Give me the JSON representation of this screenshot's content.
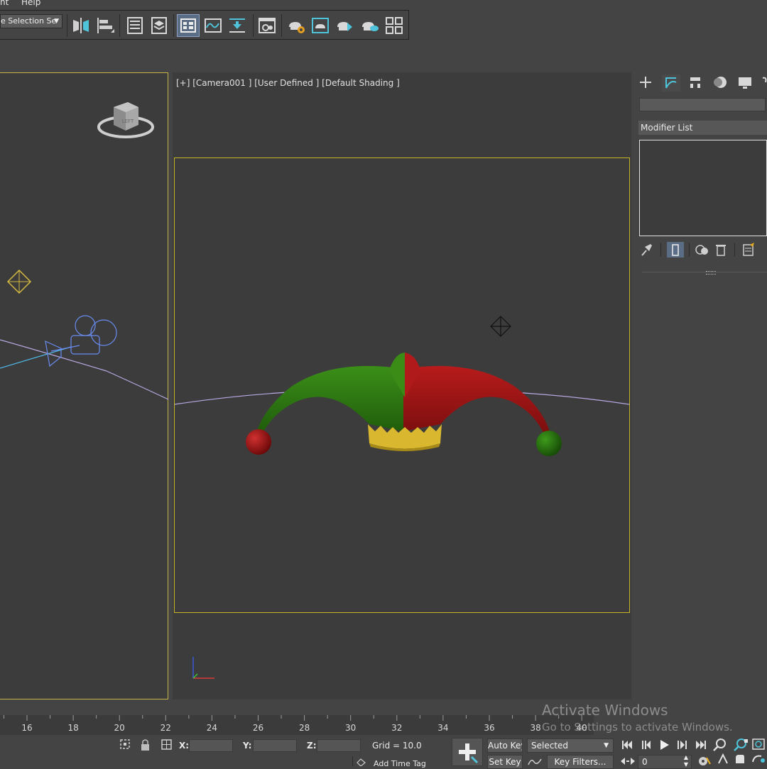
{
  "menu": {
    "item_partial": "nt",
    "help": "Help"
  },
  "toolbar": {
    "selection_set_value": "e Selection Se",
    "icons": [
      "mirror-icon",
      "align-icon",
      "layer-explorer-icon",
      "layers-icon",
      "ribbon-icon",
      "curve-editor-icon",
      "schematic-view-icon",
      "material-editor-icon",
      "render-setup-icon",
      "rendered-frame-icon",
      "render-icon",
      "render-cloud-icon",
      "render-gallery-icon"
    ]
  },
  "viewport": {
    "label": "[+] [Camera001 ] [User Defined ] [Default Shading ]",
    "viewcube_face": "LEFT"
  },
  "command_panel": {
    "modifier_list_label": "Modifier List",
    "colors": {
      "stack_border": "#e0e0e0"
    }
  },
  "timeline": {
    "ticks": [
      "16",
      "18",
      "20",
      "22",
      "24",
      "26",
      "28",
      "30",
      "32",
      "34",
      "36",
      "38",
      "40"
    ]
  },
  "status": {
    "x_label": "X:",
    "y_label": "Y:",
    "z_label": "Z:",
    "grid": "Grid = 10.0",
    "add_time_tag": "Add Time Tag",
    "auto_key": "Auto Key",
    "set_key": "Set Key",
    "selected_option": "Selected",
    "key_filters": "Key Filters...",
    "frame_value": "0"
  },
  "watermark": {
    "title": "Activate Windows",
    "subtitle": "Go to Settings to activate Windows."
  },
  "colors": {
    "hat_green": "#2f7d12",
    "hat_red": "#a31616",
    "hat_gold": "#d9b830",
    "frame_yellow": "#c8b428",
    "viewport_bg": "#3c3c3c"
  }
}
